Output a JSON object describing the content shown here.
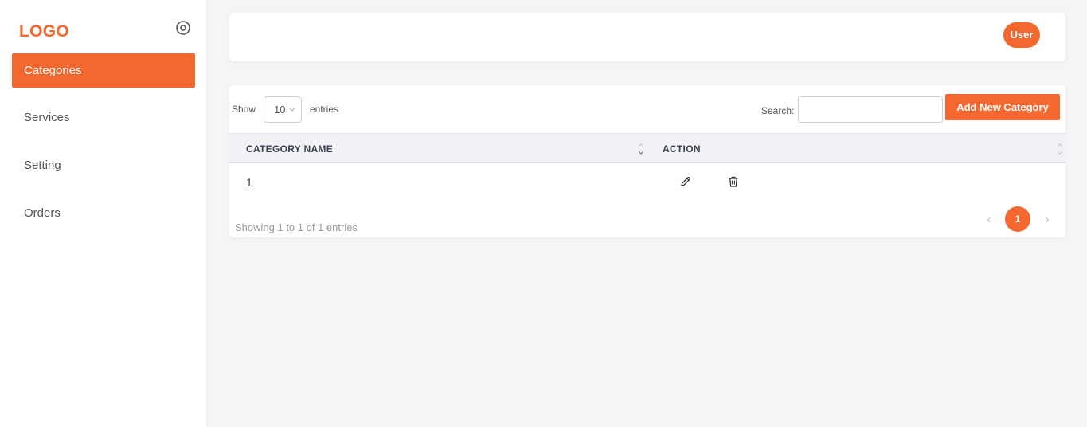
{
  "brand": {
    "logo_text": "LOGO",
    "accent_color": "#f4682f"
  },
  "sidebar": {
    "items": [
      {
        "label": "Categories",
        "active": true
      },
      {
        "label": "Services",
        "active": false
      },
      {
        "label": "Setting",
        "active": false
      },
      {
        "label": "Orders",
        "active": false
      }
    ],
    "collapse_icon": "radio-circle-icon"
  },
  "header": {
    "user_label": "User"
  },
  "table_controls": {
    "show_label": "Show",
    "page_size": "10",
    "entries_label": "entries",
    "search_label": "Search:",
    "search_value": "",
    "add_button": "Add New Category"
  },
  "table": {
    "columns": [
      "CATEGORY NAME",
      "ACTION"
    ],
    "rows": [
      {
        "name": "1",
        "actions": [
          "edit-icon",
          "trash-icon"
        ]
      }
    ]
  },
  "footer": {
    "info": "Showing 1 to 1 of 1 entries",
    "prev": "‹",
    "current_page": "1",
    "next": "›"
  }
}
